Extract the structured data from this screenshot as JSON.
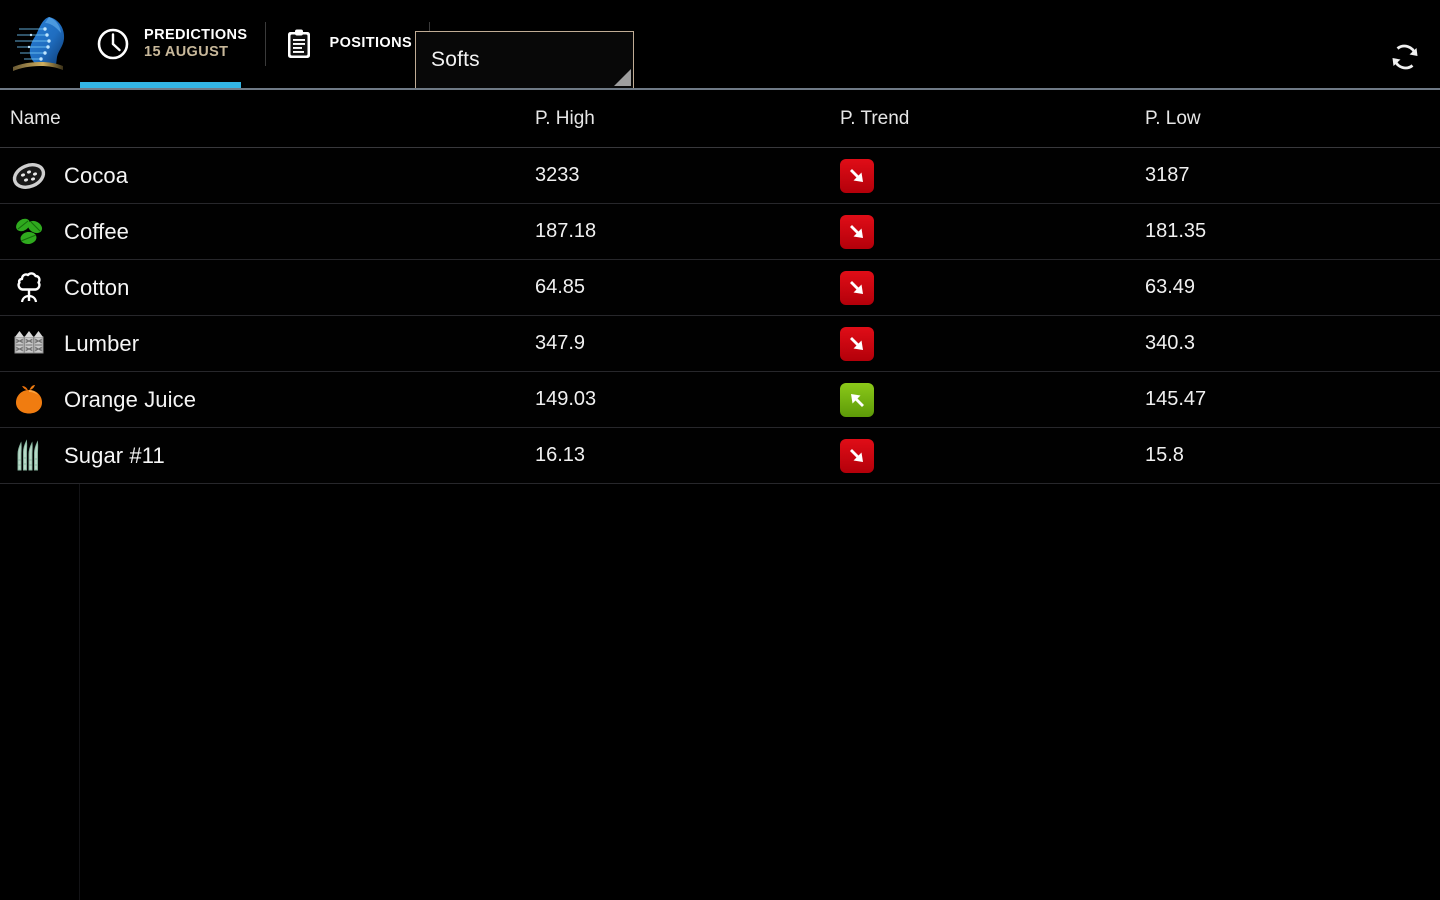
{
  "app": {
    "logo_icon": "digital-head-profile-logo",
    "refresh_icon": "refresh-sync-icon"
  },
  "topbar": {
    "tabs": [
      {
        "id": "predictions",
        "icon": "clock-icon",
        "title": "PREDICTIONS",
        "subtitle": "15 AUGUST",
        "active": true
      },
      {
        "id": "positions",
        "icon": "clipboard-icon",
        "title": "POSITIONS",
        "subtitle": "",
        "active": false
      }
    ],
    "category_dropdown": {
      "label": "category-dropdown",
      "selected": "Softs",
      "caret_icon": "dropdown-caret-icon"
    }
  },
  "colors": {
    "accent_blue": "#33b5e5",
    "dropdown_border": "#c0ac95",
    "subtitle_gold": "#c8b89a",
    "trend_down_red": "#cc0008",
    "trend_up_green": "#76b912",
    "background": "#000000",
    "row_divider": "#27272b"
  },
  "table": {
    "columns": [
      {
        "key": "name",
        "label": "Name"
      },
      {
        "key": "high",
        "label": "P. High"
      },
      {
        "key": "trend",
        "label": "P. Trend"
      },
      {
        "key": "low",
        "label": "P. Low"
      }
    ],
    "rows": [
      {
        "icon": "cocoa-pod-icon",
        "name": "Cocoa",
        "high": "3233",
        "trend": "down",
        "low": "3187"
      },
      {
        "icon": "coffee-leaves-icon",
        "name": "Coffee",
        "high": "187.18",
        "trend": "down",
        "low": "181.35"
      },
      {
        "icon": "cotton-boll-icon",
        "name": "Cotton",
        "high": "64.85",
        "trend": "down",
        "low": "63.49"
      },
      {
        "icon": "lumber-planks-icon",
        "name": "Lumber",
        "high": "347.9",
        "trend": "down",
        "low": "340.3"
      },
      {
        "icon": "orange-fruit-icon",
        "name": "Orange Juice",
        "high": "149.03",
        "trend": "up",
        "low": "145.47"
      },
      {
        "icon": "sugar-cane-icon",
        "name": "Sugar #11",
        "high": "16.13",
        "trend": "down",
        "low": "15.8"
      }
    ]
  }
}
